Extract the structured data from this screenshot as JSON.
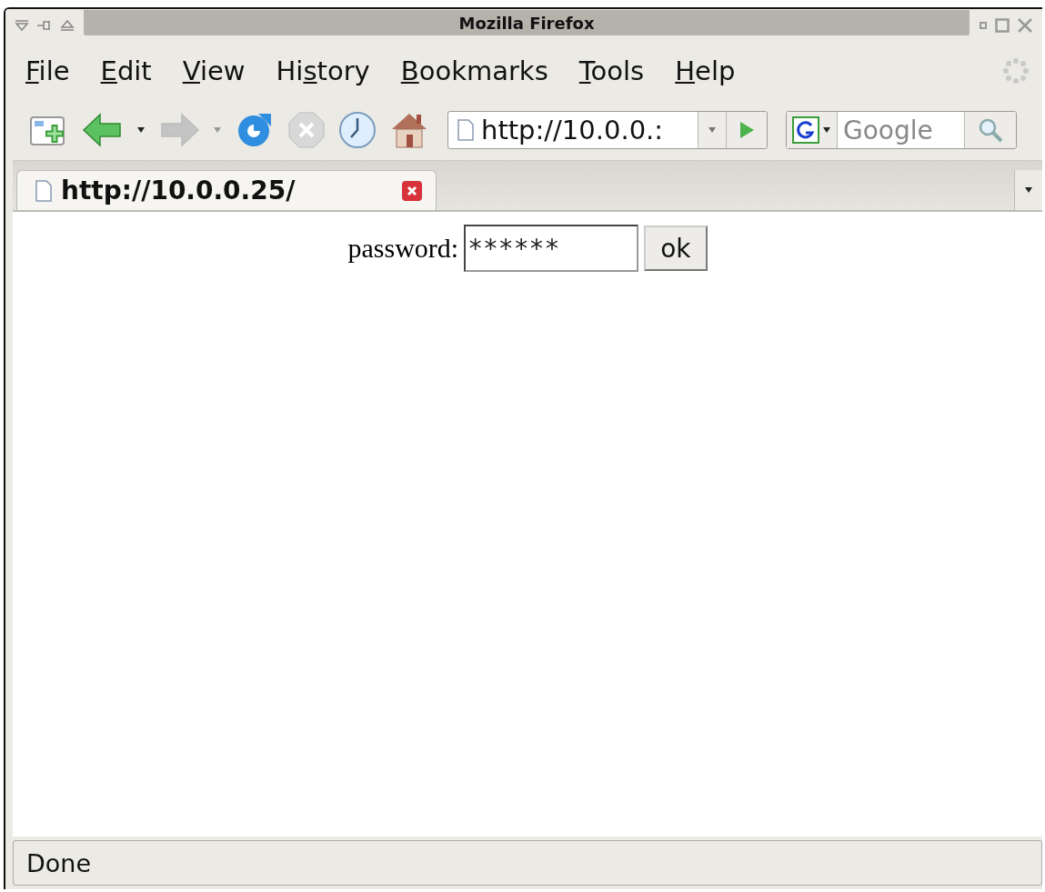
{
  "window": {
    "title": "Mozilla Firefox"
  },
  "menu": [
    {
      "key": "F",
      "after": "ile"
    },
    {
      "key": "E",
      "after": "dit"
    },
    {
      "key": "V",
      "after": "iew"
    },
    {
      "before": "Hi",
      "key": "s",
      "after": "tory"
    },
    {
      "key": "B",
      "after": "ookmarks"
    },
    {
      "key": "T",
      "after": "ools"
    },
    {
      "key": "H",
      "after": "elp"
    }
  ],
  "toolbar": {
    "back_disabled": false,
    "forward_disabled": true,
    "stop_disabled": true,
    "address": "http://10.0.0.:",
    "search_placeholder": "Google"
  },
  "tabs": [
    {
      "label": "http://10.0.0.25/",
      "selected": true
    }
  ],
  "form": {
    "label": "password:",
    "value": "******",
    "button": "ok"
  },
  "status_bar": "Done"
}
